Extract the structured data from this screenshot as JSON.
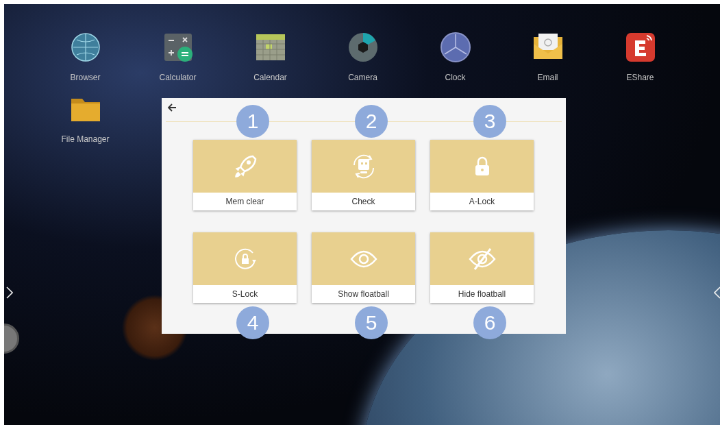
{
  "desktop": {
    "apps": [
      {
        "label": "Browser",
        "kind": "globe"
      },
      {
        "label": "Calculator",
        "kind": "calculator"
      },
      {
        "label": "Calendar",
        "kind": "calendar"
      },
      {
        "label": "Camera",
        "kind": "camera"
      },
      {
        "label": "Clock",
        "kind": "clock"
      },
      {
        "label": "Email",
        "kind": "email"
      },
      {
        "label": "EShare",
        "kind": "eshare"
      },
      {
        "label": "File Manager",
        "kind": "folder"
      }
    ]
  },
  "dialog": {
    "tiles": [
      {
        "label": "Mem clear",
        "kind": "rocket",
        "badge": "1"
      },
      {
        "label": "Check",
        "kind": "robot",
        "badge": "2"
      },
      {
        "label": "A-Lock",
        "kind": "lock",
        "badge": "3"
      },
      {
        "label": "S-Lock",
        "kind": "rotate-lock",
        "badge": "4"
      },
      {
        "label": "Show floatball",
        "kind": "eye",
        "badge": "5"
      },
      {
        "label": "Hide floatball",
        "kind": "eye-off",
        "badge": "6"
      }
    ]
  }
}
